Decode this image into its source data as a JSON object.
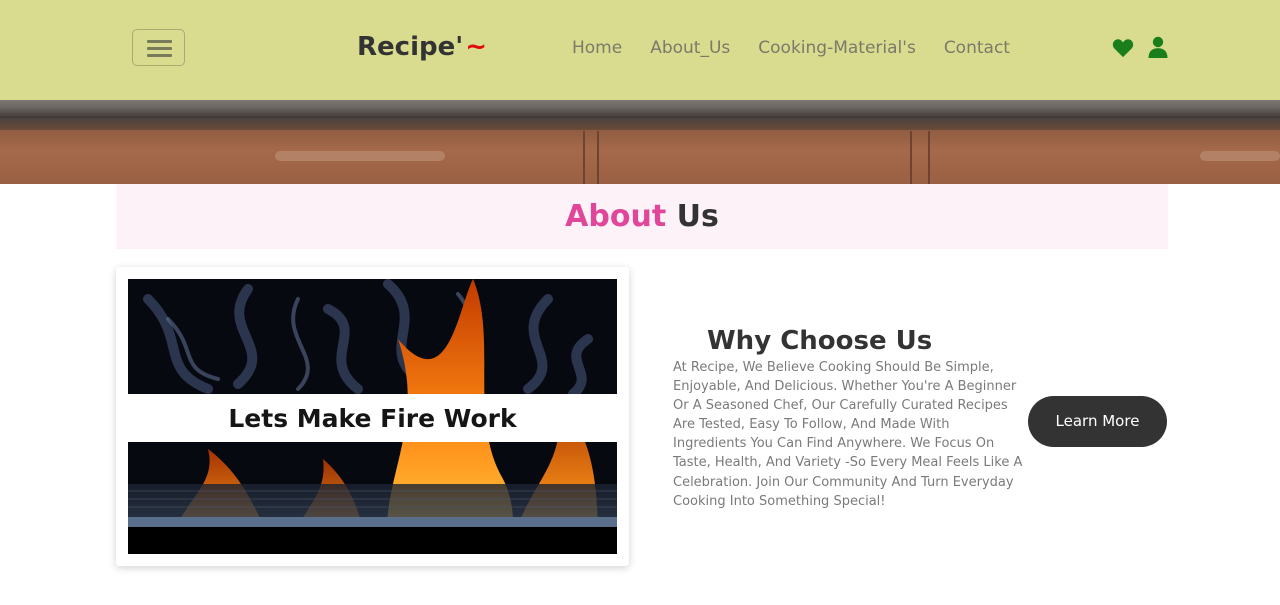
{
  "header": {
    "brand": "Recipe'",
    "brand_mark": "~",
    "nav": [
      {
        "label": "Home"
      },
      {
        "label": "About_Us"
      },
      {
        "label": "Cooking-Material's"
      },
      {
        "label": "Contact"
      }
    ],
    "icons": {
      "menu": "hamburger-icon",
      "heart": "heart-icon",
      "user": "user-icon"
    },
    "colors": {
      "background": "#d9dc8f",
      "icon": "#1a7f1a",
      "brand_mark": "#e00b0b"
    }
  },
  "about": {
    "title_accent": "About",
    "title_rest": "Us",
    "colors": {
      "accent": "#e0479a",
      "band": "#fdf2f8"
    }
  },
  "feature_card": {
    "caption": "Lets Make Fire Work"
  },
  "why": {
    "title": "Why Choose Us",
    "text": "At Recipe, We Believe Cooking Should Be Simple, Enjoyable, And Delicious. Whether You're A Beginner Or A Seasoned Chef, Our Carefully Curated Recipes Are Tested, Easy To Follow, And Made With Ingredients You Can Find Anywhere. We Focus On Taste, Health, And Variety -So Every Meal Feels Like A Celebration. Join Our Community And Turn Everyday Cooking Into Something Special!",
    "button_label": "Learn More"
  }
}
